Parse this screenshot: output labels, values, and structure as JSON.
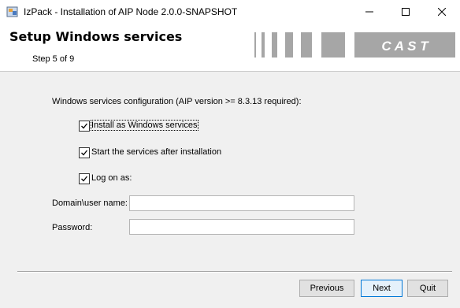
{
  "window": {
    "title": "IzPack - Installation of  AIP Node 2.0.0-SNAPSHOT",
    "icon": "izpack-app-icon",
    "controls": [
      "minimize-icon",
      "maximize-icon",
      "close-icon"
    ]
  },
  "header": {
    "title": "Setup Windows services",
    "step": "Step 5 of 9",
    "logo_text": "C A S T"
  },
  "main": {
    "section_label": "Windows services configuration (AIP version >= 8.3.13 required):",
    "checkboxes": [
      {
        "label": "Install as Windows services",
        "checked": true,
        "focused": true
      },
      {
        "label": "Start the services after installation",
        "checked": true,
        "focused": false
      },
      {
        "label": "Log on as:",
        "checked": true,
        "focused": false
      }
    ],
    "fields": {
      "domain_user": {
        "label": "Domain\\user name:",
        "value": ""
      },
      "password": {
        "label": "Password:",
        "value": ""
      }
    }
  },
  "footer": {
    "previous_label": "Previous",
    "next_label": "Next",
    "quit_label": "Quit"
  },
  "colors": {
    "logo_gray": "#a6a6a6",
    "focus_blue": "#0078d7"
  }
}
